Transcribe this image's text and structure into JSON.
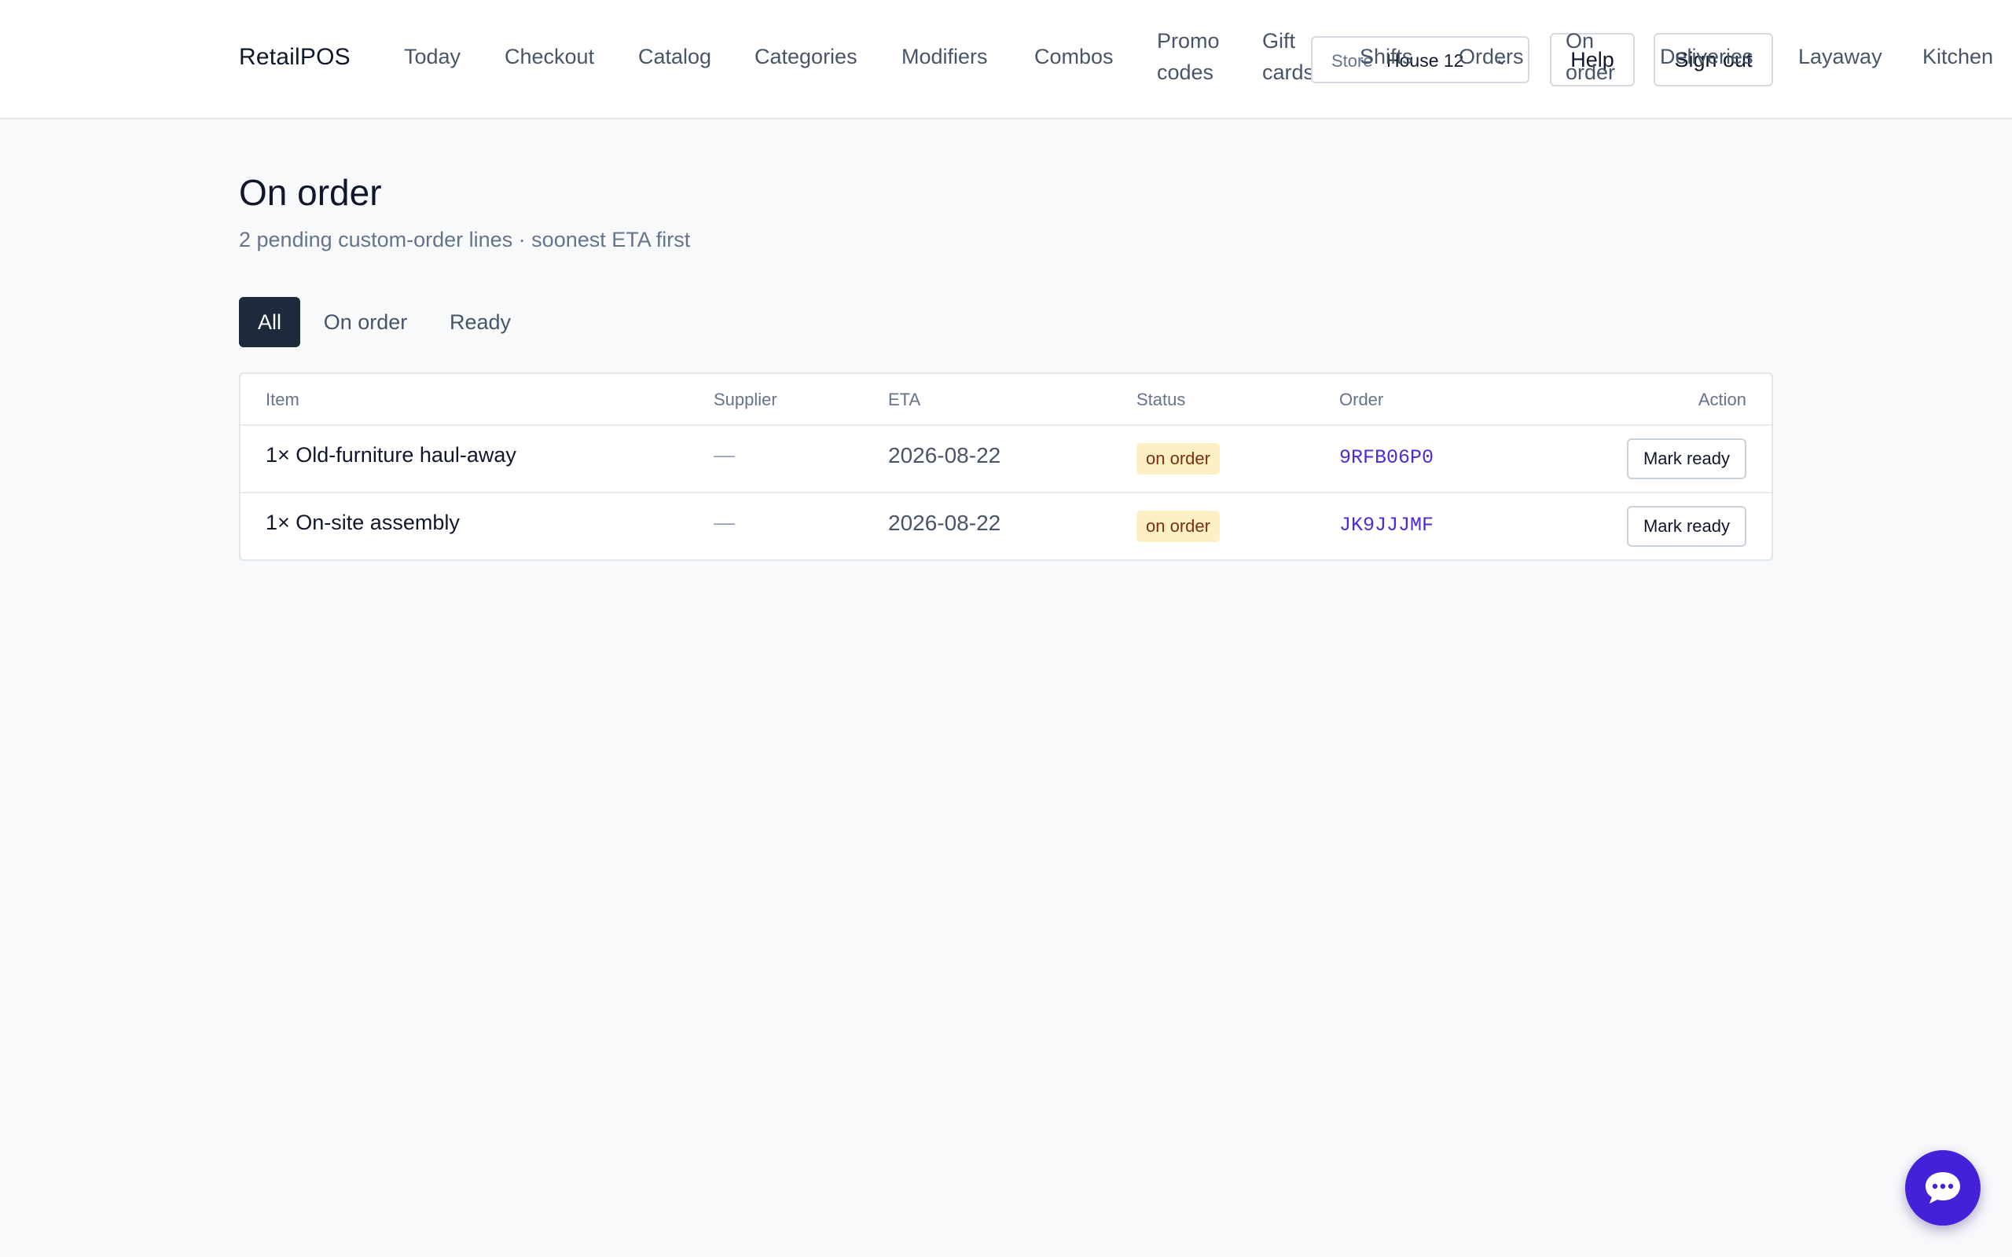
{
  "brand": "RetailPOS",
  "nav": {
    "today": "Today",
    "checkout": "Checkout",
    "catalog": "Catalog",
    "categories": "Categories",
    "modifiers": "Modifiers",
    "combos": "Combos",
    "promo_codes": "Promo codes",
    "gift_cards": "Gift cards",
    "shifts": "Shifts",
    "orders": "Orders",
    "on_order": "On order",
    "deliveries": "Deliveries",
    "layaway": "Layaway",
    "kitchen": "Kitchen"
  },
  "store": {
    "label": "Store",
    "value": "House 12",
    "chevron": "⌄"
  },
  "header_buttons": {
    "help": "Help",
    "sign_out": "Sign out"
  },
  "page": {
    "title": "On order",
    "subtitle": "2 pending custom-order lines · soonest ETA first"
  },
  "filters": [
    "All",
    "On order",
    "Ready"
  ],
  "active_filter": "All",
  "table": {
    "columns": {
      "item": "Item",
      "supplier": "Supplier",
      "eta": "ETA",
      "status": "Status",
      "order": "Order",
      "action": "Action"
    },
    "rows": [
      {
        "item": "1× Old-furniture haul-away",
        "supplier": "—",
        "eta": "2026-08-22",
        "status": "on order",
        "order": "9RFB06P0",
        "action": "Mark ready"
      },
      {
        "item": "1× On-site assembly",
        "supplier": "—",
        "eta": "2026-08-22",
        "status": "on order",
        "order": "JK9JJJMF",
        "action": "Mark ready"
      }
    ]
  },
  "chat": {
    "icon": "chat-bubble-icon"
  },
  "colors": {
    "accent": "#4421d8",
    "order_link": "#4f2bd8",
    "active_tab": "#1e293b",
    "badge_bg": "#fdf0c4",
    "badge_text": "#7c2d12"
  }
}
